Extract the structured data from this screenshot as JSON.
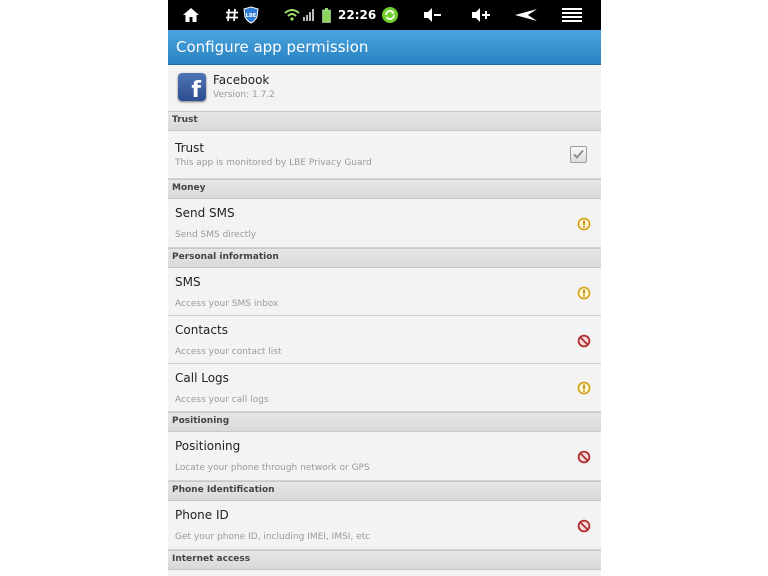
{
  "statusbar": {
    "time": "22:26",
    "icons": [
      "home-icon",
      "hash-icon",
      "lbe-shield-icon",
      "wifi-icon",
      "signal-icon",
      "battery-icon",
      "sync-icon",
      "volume-down-icon",
      "volume-up-icon",
      "back-icon",
      "menu-icon"
    ],
    "lbe_label": "LBE"
  },
  "header": {
    "title": "Configure app permission"
  },
  "app": {
    "name": "Facebook",
    "version": "Version: 1.7.2",
    "icon_letter": "f",
    "icon_color": "#3b5998"
  },
  "sections": [
    {
      "label": "Trust"
    },
    {
      "label": "Money"
    },
    {
      "label": "Personal information"
    },
    {
      "label": "Positioning"
    },
    {
      "label": "Phone Identification"
    },
    {
      "label": "Internet access"
    }
  ],
  "rows": {
    "trust": {
      "title": "Trust",
      "desc": "This app is monitored by LBE Privacy Guard",
      "checked": true
    },
    "send_sms": {
      "title": "Send SMS",
      "desc": "Send SMS directly",
      "status": "prompt"
    },
    "sms": {
      "title": "SMS",
      "desc": "Access your SMS inbox",
      "status": "prompt"
    },
    "contacts": {
      "title": "Contacts",
      "desc": "Access your contact list",
      "status": "denied"
    },
    "call_logs": {
      "title": "Call Logs",
      "desc": "Access your call logs",
      "status": "prompt"
    },
    "positioning": {
      "title": "Positioning",
      "desc": "Locate your phone through network or GPS",
      "status": "denied"
    },
    "phone_id": {
      "title": "Phone ID",
      "desc": "Get your phone ID, including IMEI, IMSI, etc",
      "status": "denied"
    }
  },
  "colors": {
    "titlebar": "#3a95d2",
    "prompt": "#d4a017",
    "denied": "#b03030"
  }
}
